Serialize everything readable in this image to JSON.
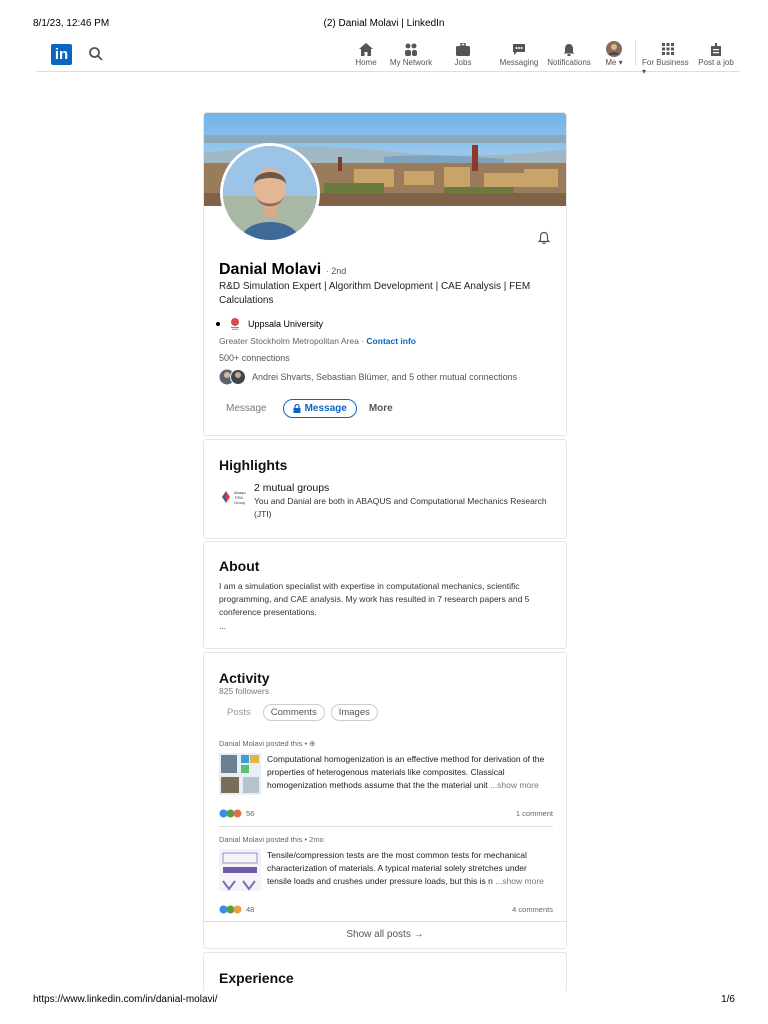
{
  "print": {
    "date": "8/1/23, 12:46 PM",
    "title": "(2) Danial Molavi | LinkedIn",
    "url": "https://www.linkedin.com/in/danial-molavi/",
    "page": "1/6"
  },
  "nav": {
    "logo": "in",
    "items": [
      {
        "label": "Home",
        "icon": "home-icon"
      },
      {
        "label": "My Network",
        "icon": "network-icon"
      },
      {
        "label": "Jobs",
        "icon": "briefcase-icon"
      },
      {
        "label": "Messaging",
        "icon": "messaging-icon"
      },
      {
        "label": "Notifications",
        "icon": "bell-icon"
      },
      {
        "label": "Me",
        "icon": "avatar-icon"
      }
    ],
    "for_business": "For Business",
    "post_job": "Post a job"
  },
  "profile": {
    "name": "Danial Molavi",
    "degree": "· 2nd",
    "headline": "R&D Simulation Expert | Algorithm Development | CAE Analysis | FEM Calculations",
    "education": "Uppsala University",
    "location": "Greater Stockholm Metropolitan Area ·",
    "contact_info": "Contact info",
    "connections": "500+ connections",
    "mutual": "Andrei Shvarts, Sebastian Blümer, and 5 other mutual connections",
    "btn_message_plain": "Message",
    "btn_message": "Message",
    "btn_more": "More"
  },
  "highlights": {
    "title": "Highlights",
    "item_title": "2 mutual groups",
    "item_text": "You and Danial are both in ABAQUS and Computational Mechanics Research (JTI)",
    "group_logo_text": "Abaqus FEA Group"
  },
  "about": {
    "title": "About",
    "text": "I am a simulation specialist with expertise in computational mechanics, scientific programming, and CAE analysis. My work has resulted in 7 research papers and 5 conference presentations.",
    "ellipsis": "..."
  },
  "activity": {
    "title": "Activity",
    "followers": "825 followers",
    "tabs": [
      "Posts",
      "Comments",
      "Images"
    ],
    "posts": [
      {
        "meta": "Danial Molavi posted this • ",
        "text": "Computational homogenization is an effective method for derivation of the properties of heterogenous materials like composites. Classical homogenization methods assume that the the material unit",
        "more": "...show more",
        "reactions": "56",
        "comments": "1 comment"
      },
      {
        "meta": "Danial Molavi posted this • 2mo",
        "text": "Tensile/compression tests are the most common tests for mechanical characterization of materials. A typical material solely stretches under tensile loads and crushes under pressure loads, but this is n",
        "more": "...show more",
        "reactions": "48",
        "comments": "4 comments"
      }
    ],
    "show_all": "Show all posts →"
  },
  "experience": {
    "title": "Experience"
  },
  "colors": {
    "brand": "#0a66c2"
  }
}
